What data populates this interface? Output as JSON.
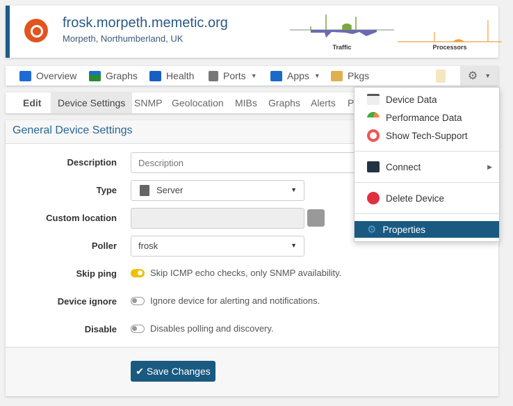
{
  "header": {
    "title": "frosk.morpeth.memetic.org",
    "location": "Morpeth, Northumberland, UK",
    "graphs": [
      {
        "label": "Traffic"
      },
      {
        "label": "Processors"
      }
    ]
  },
  "nav": {
    "items": [
      {
        "label": "Overview",
        "icon": "overview-icon",
        "color": "#1e6ad6"
      },
      {
        "label": "Graphs",
        "icon": "graphs-icon",
        "color": "#2a8a30"
      },
      {
        "label": "Health",
        "icon": "health-icon",
        "color": "#1560c0"
      },
      {
        "label": "Ports",
        "icon": "ports-icon",
        "color": "#666",
        "dropdown": true
      },
      {
        "label": "Apps",
        "icon": "apps-icon",
        "color": "#1a6ac8",
        "dropdown": true
      },
      {
        "label": "Pkgs",
        "icon": "pkgs-icon",
        "color": "#e0b050"
      }
    ]
  },
  "tabs": [
    "Edit",
    "Device Settings",
    "SNMP",
    "Geolocation",
    "MIBs",
    "Graphs",
    "Alerts",
    "P"
  ],
  "panel": {
    "title": "General Device Settings",
    "description": {
      "label": "Description",
      "placeholder": "Description"
    },
    "type": {
      "label": "Type",
      "value": "Server"
    },
    "custom_location": {
      "label": "Custom location"
    },
    "poller": {
      "label": "Poller",
      "value": "frosk"
    },
    "skip_ping": {
      "label": "Skip ping",
      "text": "Skip ICMP echo checks, only SNMP availability.",
      "on": true
    },
    "ignore": {
      "label": "Device ignore",
      "text": "Ignore device for alerting and notifications.",
      "on": false
    },
    "disable": {
      "label": "Disable",
      "text": "Disables polling and discovery.",
      "on": false
    },
    "save": "Save Changes"
  },
  "menu": {
    "items": [
      "Device Data",
      "Performance Data",
      "Show Tech-Support",
      "Connect",
      "Delete Device",
      "Properties"
    ],
    "active": "Properties"
  },
  "colors": {
    "accent": "#1a5a80",
    "title": "#2a6496",
    "toggle_on": "#f0c000"
  }
}
